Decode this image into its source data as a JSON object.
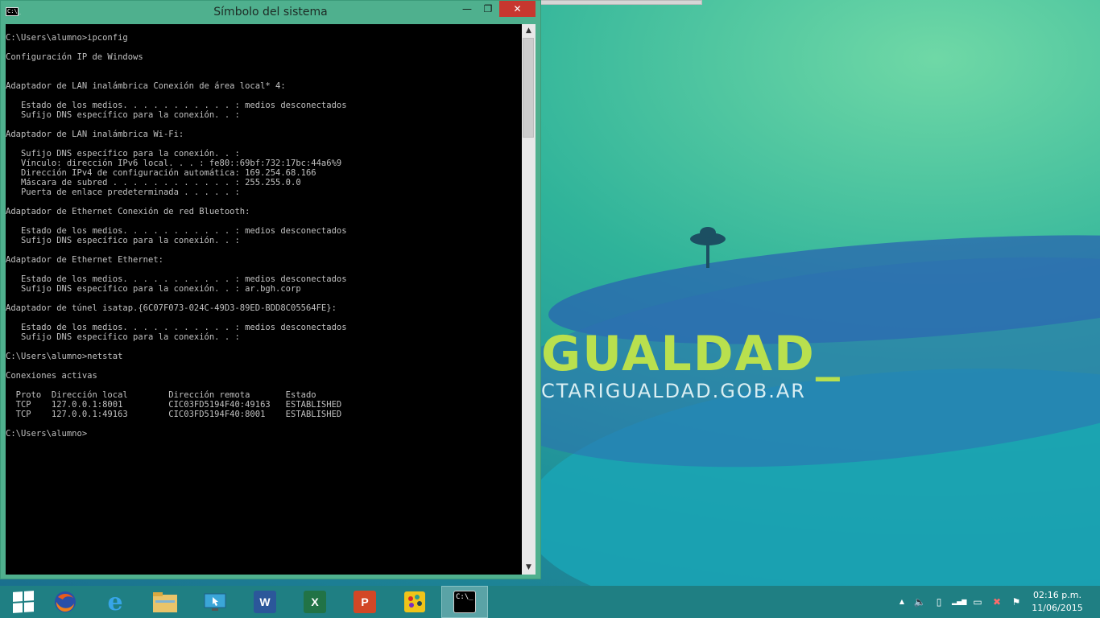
{
  "window": {
    "title": "Símbolo del sistema",
    "icon_text": "C:\\_",
    "buttons": {
      "minimize": "—",
      "maximize": "❐",
      "close": "✕"
    }
  },
  "console": {
    "lines": [
      "C:\\Users\\alumno>ipconfig",
      "",
      "Configuración IP de Windows",
      "",
      "",
      "Adaptador de LAN inalámbrica Conexión de área local* 4:",
      "",
      "   Estado de los medios. . . . . . . . . . . : medios desconectados",
      "   Sufijo DNS específico para la conexión. . :",
      "",
      "Adaptador de LAN inalámbrica Wi-Fi:",
      "",
      "   Sufijo DNS específico para la conexión. . :",
      "   Vínculo: dirección IPv6 local. . . : fe80::69bf:732:17bc:44a6%9",
      "   Dirección IPv4 de configuración automática: 169.254.68.166",
      "   Máscara de subred . . . . . . . . . . . . : 255.255.0.0",
      "   Puerta de enlace predeterminada . . . . . :",
      "",
      "Adaptador de Ethernet Conexión de red Bluetooth:",
      "",
      "   Estado de los medios. . . . . . . . . . . : medios desconectados",
      "   Sufijo DNS específico para la conexión. . :",
      "",
      "Adaptador de Ethernet Ethernet:",
      "",
      "   Estado de los medios. . . . . . . . . . . : medios desconectados",
      "   Sufijo DNS específico para la conexión. . : ar.bgh.corp",
      "",
      "Adaptador de túnel isatap.{6C07F073-024C-49D3-89ED-BDD8C05564FE}:",
      "",
      "   Estado de los medios. . . . . . . . . . . : medios desconectados",
      "   Sufijo DNS específico para la conexión. . :",
      "",
      "C:\\Users\\alumno>netstat",
      "",
      "Conexiones activas",
      "",
      "  Proto  Dirección local        Dirección remota       Estado",
      "  TCP    127.0.0.1:8001         CIC03FD5194F40:49163   ESTABLISHED",
      "  TCP    127.0.0.1:49163        CIC03FD5194F40:8001    ESTABLISHED",
      "",
      "C:\\Users\\alumno>"
    ]
  },
  "scrollbar": {
    "up": "▲",
    "down": "▼",
    "position_fraction": 0.0
  },
  "desktop": {
    "brand_text": "GUALDAD_",
    "brand_url": "CTARIGUALDAD.GOB.AR"
  },
  "taskbar": {
    "apps": [
      {
        "name": "start-button",
        "label": ""
      },
      {
        "name": "firefox",
        "label": ""
      },
      {
        "name": "internet-explorer",
        "label": "e"
      },
      {
        "name": "file-explorer",
        "label": ""
      },
      {
        "name": "app-screen",
        "label": ""
      },
      {
        "name": "word",
        "label": "W"
      },
      {
        "name": "excel",
        "label": "X"
      },
      {
        "name": "powerpoint",
        "label": "P"
      },
      {
        "name": "paint",
        "label": ""
      },
      {
        "name": "command-prompt",
        "label": "C:\\_"
      }
    ],
    "active_app": "command-prompt",
    "tray_icons": [
      "chevron-up-icon",
      "volume-icon",
      "battery-icon",
      "network-signal-icon",
      "display-icon",
      "network-x-icon",
      "flag-icon"
    ],
    "tray_glyphs": {
      "chevron": "▲",
      "volume": "🔈",
      "battery": "▯",
      "signal": "▂▄▆",
      "display": "▭",
      "netx": "✖",
      "flag": "⚑"
    },
    "clock": {
      "time": "02:16 p.m.",
      "date": "11/06/2015"
    }
  },
  "colors": {
    "console_bg": "#000000",
    "console_fg": "#c0c0c0",
    "window_border": "#4fb08e",
    "close_button": "#c7372f",
    "taskbar": "#1f7f83",
    "brand_green": "#b9e04e"
  }
}
